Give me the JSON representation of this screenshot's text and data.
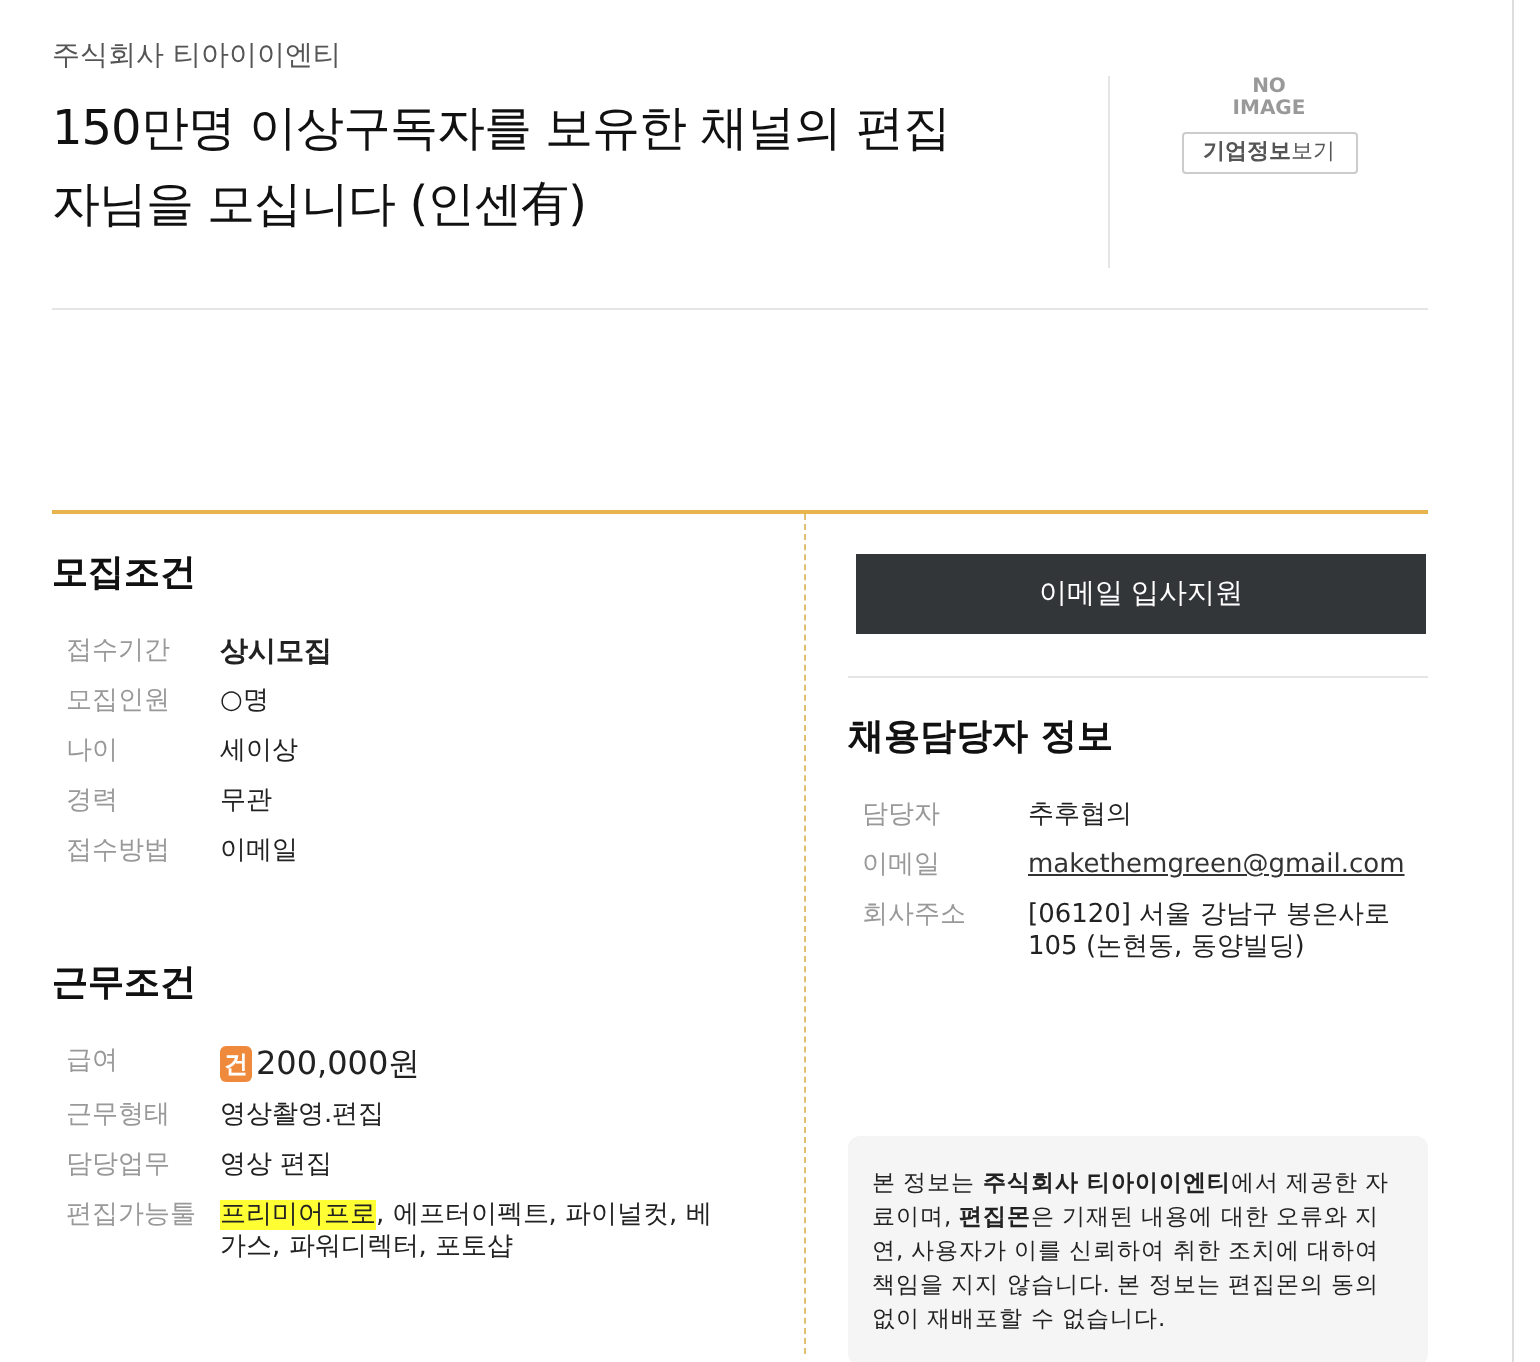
{
  "header": {
    "company": "주식회사 티아이이엔티",
    "title": "150만명 이상구독자를 보유한 채널의 편집자님을 모십니다 (인센有)",
    "logo_text": "NO IMAGE",
    "company_info_button": "**기업정보**보기"
  },
  "recruit": {
    "heading": "모집조건",
    "rows": [
      {
        "label": "접수기간",
        "value": "상시모집",
        "kind": "strong"
      },
      {
        "label": "모집인원",
        "value": "○명",
        "kind": "plain"
      },
      {
        "label": "나이",
        "value": "세이상",
        "kind": "plain"
      },
      {
        "label": "경력",
        "value": "무관",
        "kind": "plain"
      },
      {
        "label": "접수방법",
        "value": "이메일",
        "kind": "plain"
      }
    ]
  },
  "work": {
    "heading": "근무조건",
    "rows": [
      {
        "label": "급여",
        "kind": "salary",
        "badge": "건",
        "value": "200,000원"
      },
      {
        "label": "근무형태",
        "kind": "plain",
        "value": "영상촬영.편집"
      },
      {
        "label": "담당업무",
        "kind": "plain",
        "value": "영상 편집"
      },
      {
        "label": "편집가능툴",
        "kind": "parts",
        "parts": [
          {
            "text": "프리미어프로",
            "highlighted": true
          },
          {
            "text": ", 에프터이펙트, 파이널컷, 베가스, 파워디렉터, 포토샵",
            "highlighted": false
          }
        ]
      }
    ]
  },
  "apply_button": "이메일 입사지원",
  "contact": {
    "heading": "채용담당자 정보",
    "rows": [
      {
        "label": "담당자",
        "value": "추후협의",
        "kind": "plain"
      },
      {
        "label": "이메일",
        "value": "makethemgreen@gmail.com",
        "kind": "link"
      },
      {
        "label": "회사주소",
        "value": "[06120] 서울 강남구 봉은사로 105 (논현동, 동양빌딩)",
        "kind": "plain"
      }
    ]
  },
  "disclaimer": "본 정보는 **주식회사 티아이이엔티**에서 제공한 자료이며, **편집몬**은 기재된 내용에 대한 오류와 지연, 사용자가 이를 신뢰하여 취한 조치에 대하여 책임을 지지 않습니다. 본 정보는 편집몬의 동의 없이 재배포할 수 없습니다."
}
